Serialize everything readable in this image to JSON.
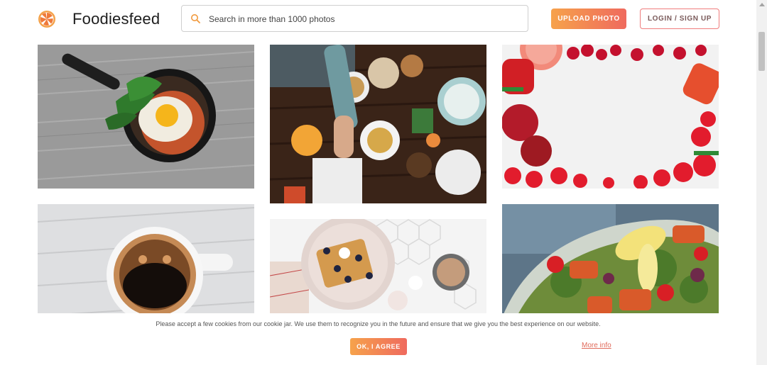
{
  "header": {
    "brand": "Foodiesfeed",
    "search_placeholder": "Search in more than 1000 photos",
    "upload_label": "UPLOAD PHOTO",
    "login_label": "LOGIN / SIGN UP"
  },
  "gallery": {
    "photos": [
      "egg-skillet-photo",
      "dinner-table-photo",
      "vegetables-frame-photo",
      "coffee-cup-photo",
      "waffles-breakfast-photo",
      "salmon-salad-photo"
    ]
  },
  "cookie": {
    "message": "Please accept a few cookies from our cookie jar. We use them to recognize you in the future and ensure that we give you the best experience on our website.",
    "agree_label": "OK, I AGREE",
    "more_label": "More info"
  },
  "colors": {
    "accent_start": "#f6a24b",
    "accent_end": "#ef6a5e",
    "link": "#e06a5a"
  }
}
